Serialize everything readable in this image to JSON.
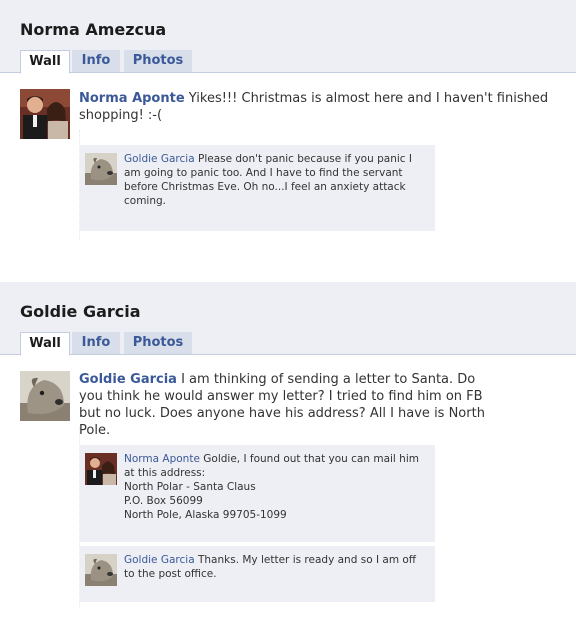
{
  "profiles": [
    {
      "name": "Norma Amezcua",
      "tabs": [
        {
          "label": "Wall"
        },
        {
          "label": "Info"
        },
        {
          "label": "Photos"
        }
      ],
      "post": {
        "author": "Norma Aponte",
        "text": "Yikes!!! Christmas is almost here and I haven't finished shopping! :-("
      },
      "comments": [
        {
          "author": "Goldie Garcia",
          "text": "Please don't panic because if you panic I am going to panic too. And I have to find the servant before Christmas Eve. Oh no...I feel an anxiety attack coming."
        }
      ]
    },
    {
      "name": "Goldie Garcia",
      "tabs": [
        {
          "label": "Wall"
        },
        {
          "label": "Info"
        },
        {
          "label": "Photos"
        }
      ],
      "post": {
        "author": "Goldie Garcia",
        "text": "I am thinking of sending a letter to Santa. Do you think he would answer my letter? I tried to find him on FB but no luck. Does anyone have his address? All I have is North Pole."
      },
      "comments": [
        {
          "author": "Norma Aponte",
          "text": "Goldie, I found out that you can mail him at this address:",
          "address": [
            "North Polar - Santa Claus",
            "P.O. Box 56099",
            "North Pole, Alaska 99705-1099"
          ]
        },
        {
          "author": "Goldie Garcia",
          "text": "Thanks. My letter is ready and so I am off to the post office."
        }
      ]
    }
  ],
  "colors": {
    "link": "#3b5998",
    "header_bg": "#edeff4",
    "tab_bg": "#d8dfea",
    "comment_bg": "#edeff4"
  },
  "icons": {
    "couple_photo": "couple-avatar-icon",
    "dog_photo": "dog-avatar-icon"
  }
}
